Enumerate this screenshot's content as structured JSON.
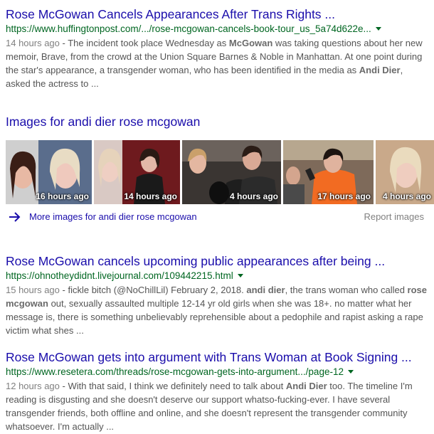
{
  "results": [
    {
      "title": "Rose McGowan Cancels Appearances After Trans Rights ...",
      "url": "https://www.huffingtonpost.com/.../rose-mcgowan-cancels-book-tour_us_5a74d622e...",
      "date": "14 hours ago",
      "snippet_parts": [
        {
          "t": " - The incident took place Wednesday as ",
          "b": false
        },
        {
          "t": "McGowan",
          "b": true
        },
        {
          "t": " was taking questions about her new memoir, Brave, from the crowd at the Union Square Barnes & Noble in Manhattan. At one point during the star's appearance, a transgender woman, who has been identified in the media as ",
          "b": false
        },
        {
          "t": "Andi Dier",
          "b": true
        },
        {
          "t": ", asked the actress to ...",
          "b": false
        }
      ]
    },
    {
      "title": "Rose McGowan cancels upcoming public appearances after being ...",
      "url": "https://ohnotheydidnt.livejournal.com/109442215.html",
      "date": "15 hours ago",
      "snippet_parts": [
        {
          "t": " - fickle bitch (@NoChillLil) February 2, 2018. ",
          "b": false
        },
        {
          "t": "andi dier",
          "b": true
        },
        {
          "t": ", the trans woman who called ",
          "b": false
        },
        {
          "t": "rose mcgowan",
          "b": true
        },
        {
          "t": " out, sexually assaulted multiple 12-14 yr old girls when she was 18+. no matter what her message is, there is something unbelievably reprehensible about a pedophile and rapist asking a rape victim what shes ...",
          "b": false
        }
      ]
    },
    {
      "title": "Rose McGowan gets into argument with Trans Woman at Book Signing ...",
      "url": "https://www.resetera.com/threads/rose-mcgowan-gets-into-argument.../page-12",
      "date": "12 hours ago",
      "snippet_parts": [
        {
          "t": " - With that said, I think we definitely need to talk about ",
          "b": false
        },
        {
          "t": "Andi Dier",
          "b": true
        },
        {
          "t": " too. The timeline I'm reading is disgusting and she doesn't deserve our support whatso-fucking-ever. I have several transgender friends, both offline and online, and she doesn't represent the transgender community whatsoever. I'm actually ...",
          "b": false
        }
      ]
    }
  ],
  "images": {
    "heading": "Images for andi dier rose mcgowan",
    "thumbs": [
      {
        "time": "16 hours ago"
      },
      {
        "time": "14 hours ago"
      },
      {
        "time": "4 hours ago"
      },
      {
        "time": "17 hours ago"
      },
      {
        "time": "4 hours ago"
      }
    ],
    "more_label": "More images for andi dier rose mcgowan",
    "report_label": "Report images"
  },
  "colors": {
    "link": "#1a0dab",
    "url": "#006621",
    "snippet": "#545454"
  }
}
